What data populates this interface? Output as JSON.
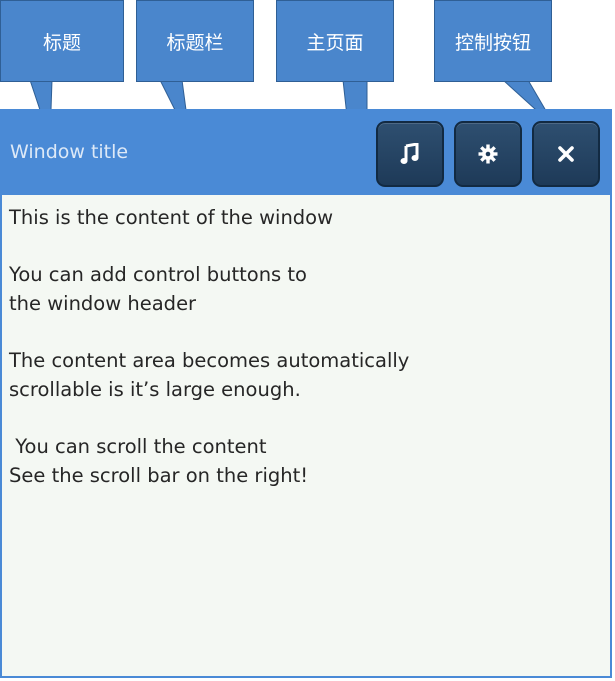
{
  "callouts": {
    "title": "标题",
    "titlebar": "标题栏",
    "main_page": "主页面",
    "control_buttons": "控制按钮"
  },
  "window": {
    "title": "Window title",
    "buttons": [
      {
        "name": "music",
        "icon": "music-icon"
      },
      {
        "name": "settings",
        "icon": "gear-icon"
      },
      {
        "name": "close",
        "icon": "close-icon"
      }
    ],
    "content": {
      "p1": "This is the content of the window",
      "p2": "You can add control buttons to\nthe window header",
      "p3": "The content area becomes automatically\nscrollable is it’s large enough.",
      "p4": " You can scroll the content\nSee the scroll bar on the right!"
    }
  },
  "colors": {
    "callout": "#4a86cc",
    "titlebar": "#4a8ad6",
    "button": "#1e3a58",
    "content_bg": "#f4f8f3"
  }
}
